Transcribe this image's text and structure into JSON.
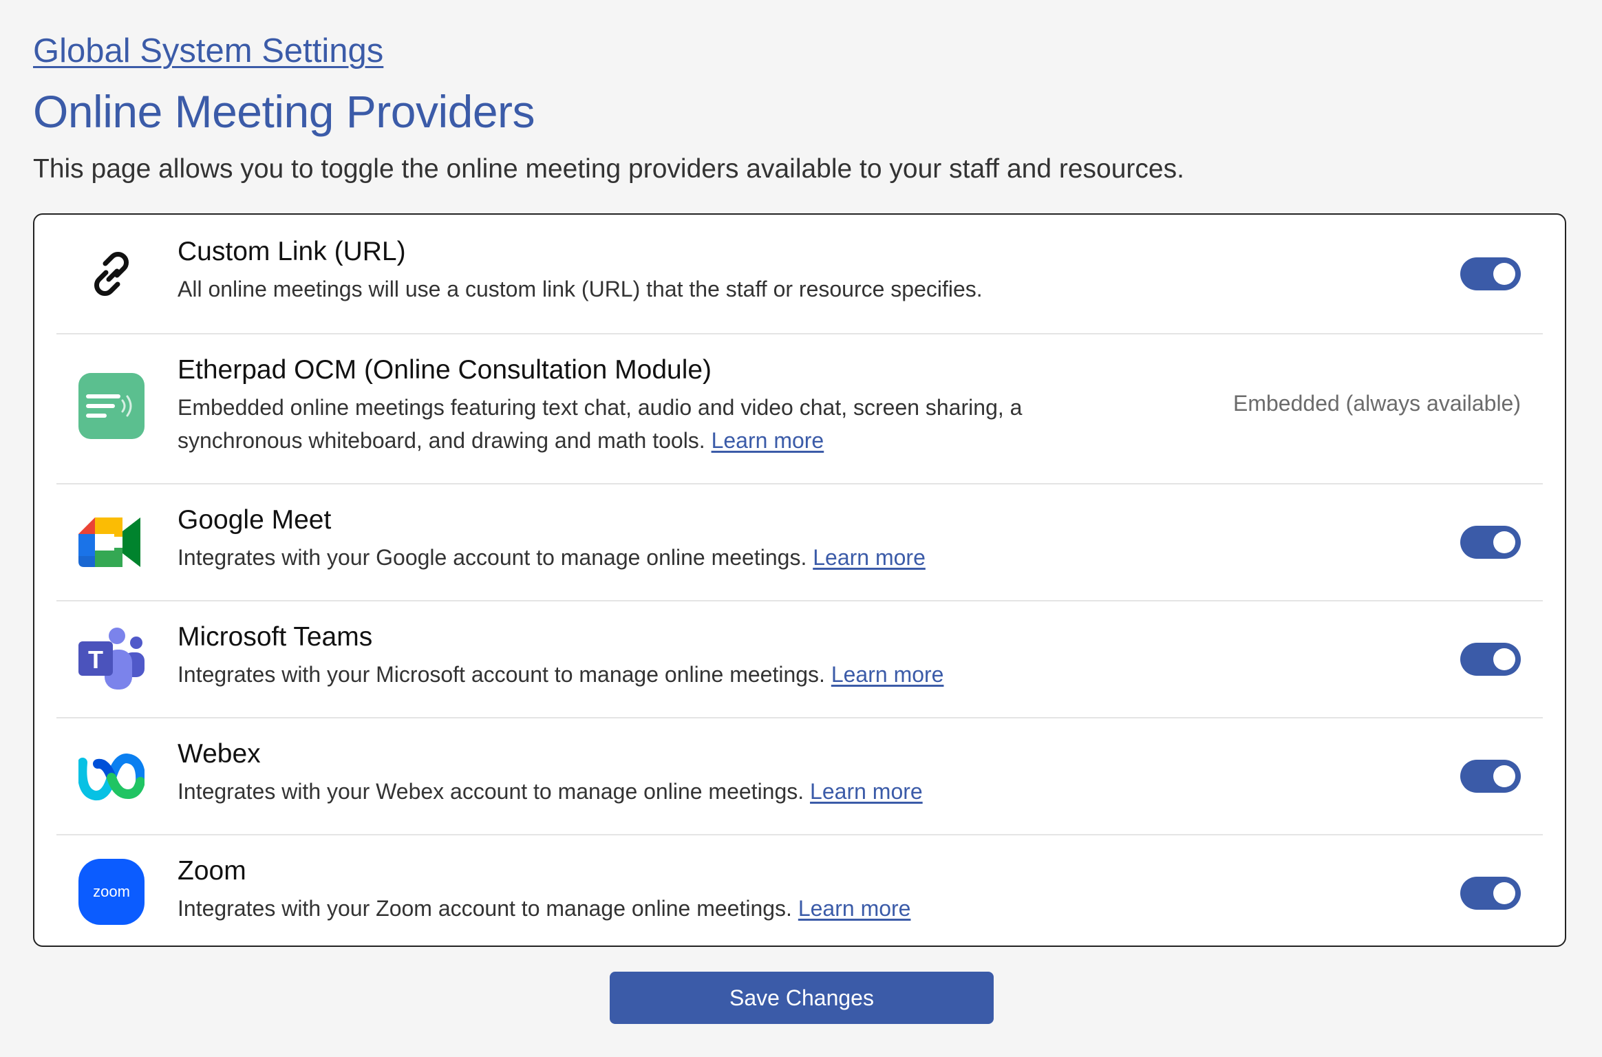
{
  "breadcrumb": {
    "label": "Global System Settings"
  },
  "page": {
    "title": "Online Meeting Providers",
    "description": "This page allows you to toggle the online meeting providers available to your staff and resources."
  },
  "providers": [
    {
      "name": "Custom Link (URL)",
      "description": "All online meetings will use a custom link (URL) that the staff or resource specifies.",
      "icon": "link-icon",
      "enabled": true
    },
    {
      "name": "Etherpad OCM (Online Consultation Module)",
      "description": "Embedded online meetings featuring text chat, audio and video chat, screen sharing, a synchronous whiteboard, and drawing and math tools.",
      "link": "Learn more",
      "icon": "etherpad-icon",
      "status": "Embedded (always available)"
    },
    {
      "name": "Google Meet",
      "description": "Integrates with your Google account to manage online meetings.",
      "link": "Learn more",
      "icon": "google-meet-icon",
      "enabled": true
    },
    {
      "name": "Microsoft Teams",
      "description": "Integrates with your Microsoft account to manage online meetings.",
      "link": "Learn more",
      "icon": "microsoft-teams-icon",
      "enabled": true
    },
    {
      "name": "Webex",
      "description": "Integrates with your Webex account to manage online meetings.",
      "link": "Learn more",
      "icon": "webex-icon",
      "enabled": true
    },
    {
      "name": "Zoom",
      "description": "Integrates with your Zoom account to manage online meetings.",
      "link": "Learn more",
      "icon": "zoom-icon",
      "icon_text": "zoom",
      "enabled": true
    }
  ],
  "actions": {
    "save_label": "Save Changes"
  },
  "colors": {
    "accent": "#3b5ba8",
    "background": "#f5f5f5",
    "toggle_on": "#3b5ba8",
    "etherpad": "#5bbf8f",
    "zoom": "#0b5cff"
  }
}
